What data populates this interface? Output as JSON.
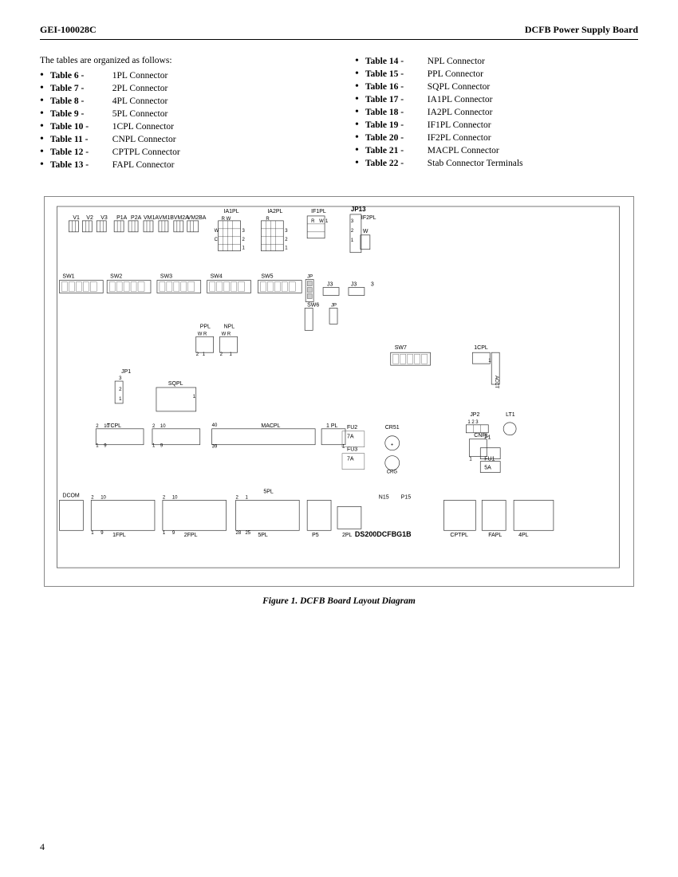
{
  "header": {
    "left": "GEI-100028C",
    "right": "DCFB Power Supply Board"
  },
  "intro": "The tables are organized as follows:",
  "left_tables": [
    {
      "ref": "Table 6 -",
      "desc": "1PL Connector"
    },
    {
      "ref": "Table 7 -",
      "desc": "2PL Connector"
    },
    {
      "ref": "Table 8 -",
      "desc": "4PL Connector"
    },
    {
      "ref": "Table 9 -",
      "desc": "5PL Connector"
    },
    {
      "ref": "Table 10 -",
      "desc": "1CPL Connector"
    },
    {
      "ref": "Table 11 -",
      "desc": "CNPL Connector"
    },
    {
      "ref": "Table 12 -",
      "desc": "CPTPL Connector"
    },
    {
      "ref": "Table 13 -",
      "desc": "FAPL Connector"
    }
  ],
  "right_tables": [
    {
      "ref": "Table 14 -",
      "desc": "NPL Connector"
    },
    {
      "ref": "Table 15 -",
      "desc": "PPL Connector"
    },
    {
      "ref": "Table 16 -",
      "desc": "SQPL Connector"
    },
    {
      "ref": "Table 17 -",
      "desc": "IA1PL Connector"
    },
    {
      "ref": "Table 18 -",
      "desc": "IA2PL Connector"
    },
    {
      "ref": "Table 19 -",
      "desc": "IF1PL Connector"
    },
    {
      "ref": "Table 20 -",
      "desc": "IF2PL Connector"
    },
    {
      "ref": "Table 21 -",
      "desc": "MACPL Connector"
    },
    {
      "ref": "Table 22 -",
      "desc": "Stab Connector Terminals"
    }
  ],
  "figure_caption": "Figure 1.  DCFB Board Layout Diagram",
  "page_number": "4"
}
